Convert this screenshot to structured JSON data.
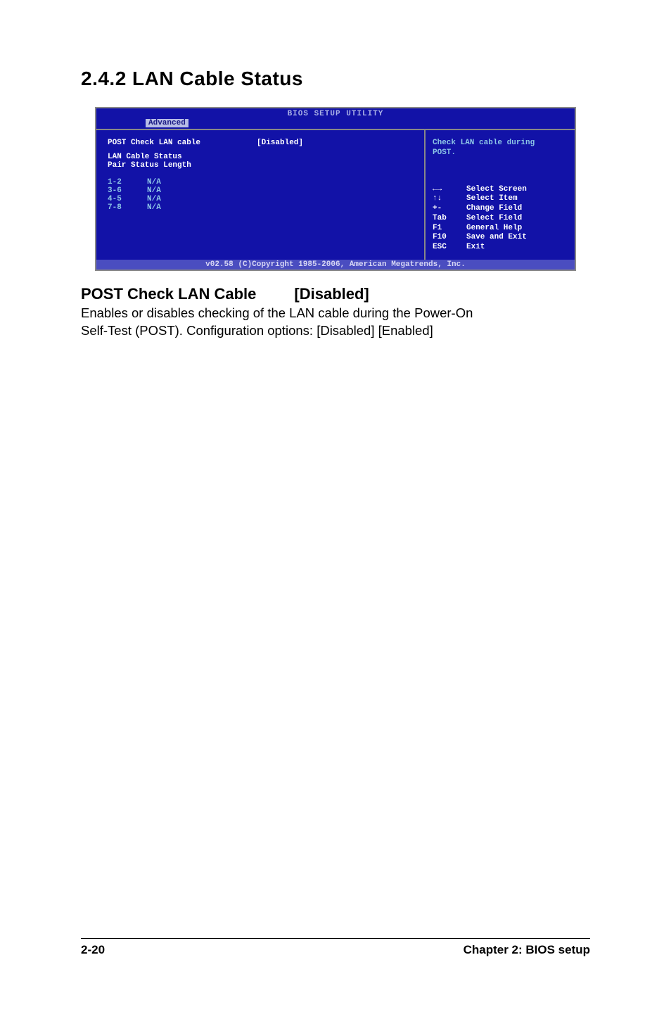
{
  "heading": "2.4.2   LAN Cable Status",
  "bios": {
    "title": "BIOS SETUP UTILITY",
    "tab_active": "Advanced",
    "item_label": "POST Check LAN cable",
    "item_value": "[Disabled]",
    "sub_head1": "LAN Cable Status",
    "sub_head2": "Pair  Status  Length",
    "rows": [
      {
        "pair": "1-2",
        "status": "N/A"
      },
      {
        "pair": "3-6",
        "status": "N/A"
      },
      {
        "pair": "4-5",
        "status": "N/A"
      },
      {
        "pair": "7-8",
        "status": "N/A"
      }
    ],
    "help_line1": "Check LAN cable during",
    "help_line2": "POST.",
    "keys": [
      {
        "k": "←→",
        "d": "Select Screen"
      },
      {
        "k": "↑↓",
        "d": "Select Item"
      },
      {
        "k": "+-",
        "d": "Change Field"
      },
      {
        "k": "Tab",
        "d": "Select Field"
      },
      {
        "k": "F1",
        "d": "General Help"
      },
      {
        "k": "F10",
        "d": "Save and Exit"
      },
      {
        "k": "ESC",
        "d": "Exit"
      }
    ],
    "footer": "v02.58 (C)Copyright 1985-2006, American Megatrends, Inc."
  },
  "sub": {
    "heading_left": "POST Check LAN Cable",
    "heading_right": "[Disabled]",
    "body_l1": "Enables or disables checking of the LAN cable during the Power-On",
    "body_l2": "Self-Test (POST). Configuration options: [Disabled] [Enabled]"
  },
  "footer": {
    "left": "2-20",
    "right": "Chapter 2: BIOS setup"
  }
}
